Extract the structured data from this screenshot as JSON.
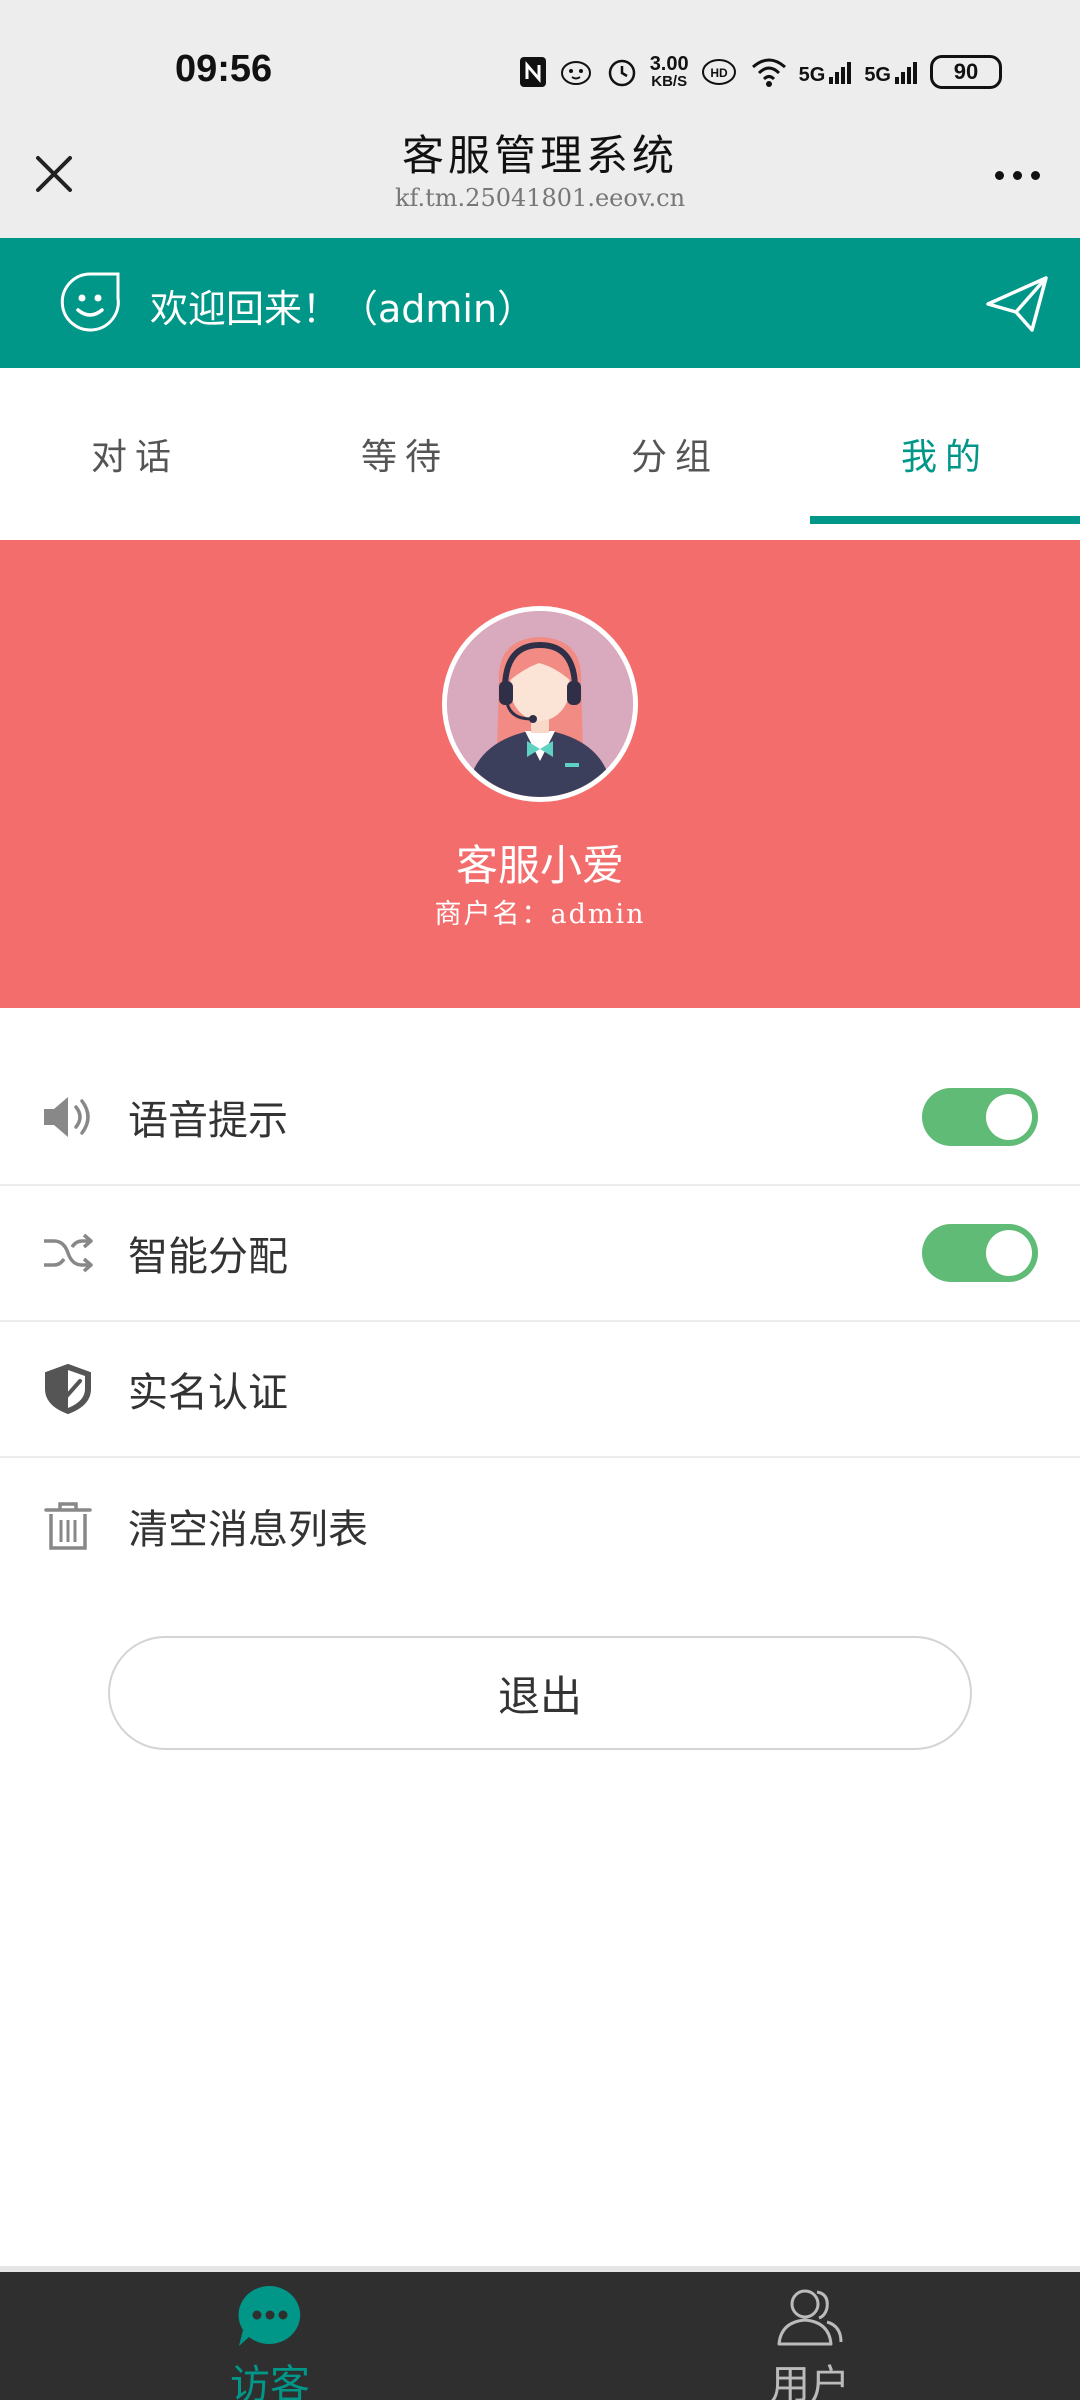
{
  "status_bar": {
    "time": "09:56",
    "speed_value": "3.00",
    "speed_unit": "KB/S",
    "network_1": "5G",
    "network_2": "5G",
    "battery": "90"
  },
  "browser": {
    "title": "客服管理系统",
    "url": "kf.tm.25041801.eeov.cn"
  },
  "welcome": {
    "text": "欢迎回来！（admin）"
  },
  "tabs": [
    {
      "label": "对话",
      "active": false
    },
    {
      "label": "等待",
      "active": false
    },
    {
      "label": "分组",
      "active": false
    },
    {
      "label": "我的",
      "active": true
    }
  ],
  "profile": {
    "name": "客服小爱",
    "merchant": "商户名：admin"
  },
  "settings": [
    {
      "icon": "speaker-icon",
      "label": "语音提示",
      "toggle": true
    },
    {
      "icon": "shuffle-icon",
      "label": "智能分配",
      "toggle": true
    },
    {
      "icon": "shield-check-icon",
      "label": "实名认证"
    },
    {
      "icon": "trash-icon",
      "label": "清空消息列表"
    }
  ],
  "logout_label": "退出",
  "bottom_nav": [
    {
      "icon": "chat-bubble-icon",
      "label": "访客",
      "active": true
    },
    {
      "icon": "users-icon",
      "label": "用户",
      "active": false
    }
  ],
  "colors": {
    "primary": "#009688",
    "profile_bg": "#f36d6d",
    "toggle_on": "#5fbb76",
    "nav_bg": "#2f2f2f"
  }
}
